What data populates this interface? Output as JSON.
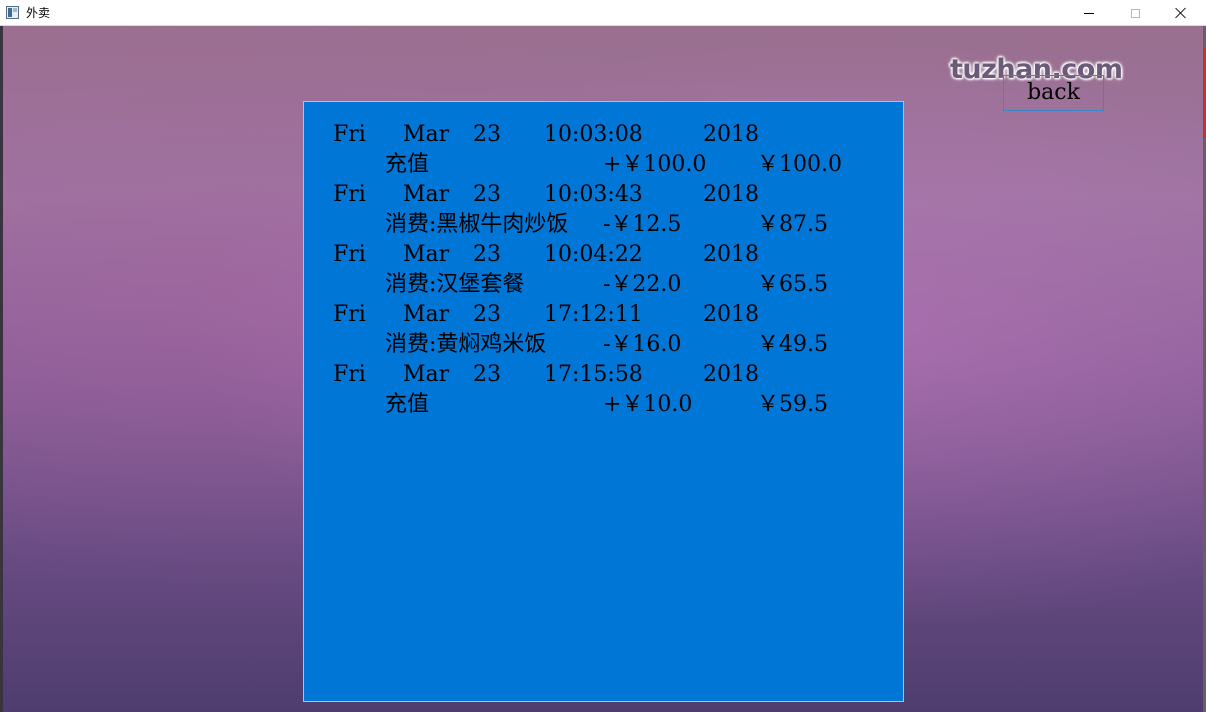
{
  "window": {
    "title": "外卖",
    "minimize_glyph": "minimize-icon",
    "maximize_glyph": "maximize-icon",
    "close_glyph": "close-icon"
  },
  "watermark": "tuzhan.com",
  "back_button": {
    "label": "back"
  },
  "records": [
    {
      "weekday": "Fri",
      "month": "Mar",
      "day": "23",
      "time": "10:03:08",
      "year": "2018",
      "desc": "充值",
      "amount": "+￥100.0",
      "balance": "￥100.0"
    },
    {
      "weekday": "Fri",
      "month": "Mar",
      "day": "23",
      "time": "10:03:43",
      "year": "2018",
      "desc": "消费:黑椒牛肉炒饭",
      "amount": "-￥12.5",
      "balance": "￥87.5"
    },
    {
      "weekday": "Fri",
      "month": "Mar",
      "day": "23",
      "time": "10:04:22",
      "year": "2018",
      "desc": "消费:汉堡套餐",
      "amount": "-￥22.0",
      "balance": "￥65.5"
    },
    {
      "weekday": "Fri",
      "month": "Mar",
      "day": "23",
      "time": "17:12:11",
      "year": "2018",
      "desc": "消费:黄焖鸡米饭",
      "amount": "-￥16.0",
      "balance": "￥49.5"
    },
    {
      "weekday": "Fri",
      "month": "Mar",
      "day": "23",
      "time": "17:15:58",
      "year": "2018",
      "desc": "充值",
      "amount": "+￥10.0",
      "balance": "￥59.5"
    }
  ]
}
